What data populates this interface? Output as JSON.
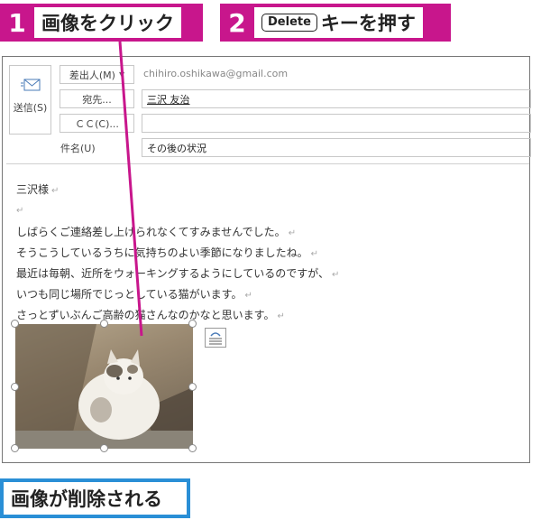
{
  "steps": [
    {
      "number": "1",
      "text": "画像をクリック"
    },
    {
      "number": "2",
      "key": "Delete",
      "text": "キーを押す"
    }
  ],
  "compose": {
    "send_label": "送信(S)",
    "from_button": "差出人(M)",
    "to_button": "宛先...",
    "cc_button": "ＣＣ(C)...",
    "subject_label": "件名(U)",
    "from_value": "chihiro.oshikawa@gmail.com",
    "to_value": "三沢 友治",
    "cc_value": "",
    "subject_value": "その後の状況"
  },
  "body": {
    "salutation": "三沢様",
    "lines": [
      "しばらくご連絡差し上げられなくてすみませんでした。",
      "そうこうしているうちに気持ちのよい季節になりましたね。",
      "最近は毎朝、近所をウォーキングするようにしているのですが、",
      "いつも同じ場所でじっとしている猫がいます。",
      "さっとずいぶんご高齢の猫さんなのかなと思います。"
    ],
    "para_mark": "↵"
  },
  "image": {
    "subject": "cat-photo"
  },
  "result": {
    "text": "画像が削除される"
  },
  "colors": {
    "step_accent": "#c8168c",
    "result_accent": "#2a8fd6"
  }
}
